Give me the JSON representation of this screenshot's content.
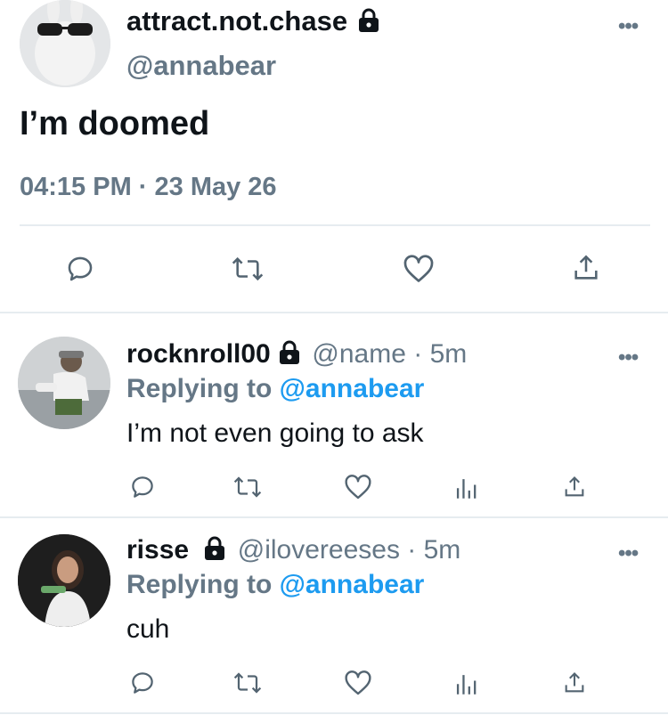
{
  "main_tweet": {
    "display_name": "attract.not.chase",
    "handle": "@annabear",
    "text": "I’m doomed",
    "timestamp": "04:15 PM · 23 May 26"
  },
  "replies": [
    {
      "display_name": "rocknroll00",
      "handle_time": "@name · 5m",
      "replying_prefix": "Replying to ",
      "replying_handle": "@annabear",
      "text": "I’m not even going to ask"
    },
    {
      "display_name": "risse",
      "handle_time": "@ilovereeses · 5m",
      "replying_prefix": "Replying to ",
      "replying_handle": "@annabear",
      "text": "cuh"
    }
  ],
  "more_label": "•••",
  "colors": {
    "text": "#0f1419",
    "muted": "#657786",
    "link": "#1d9bf0",
    "divider": "#e6ecf0"
  }
}
